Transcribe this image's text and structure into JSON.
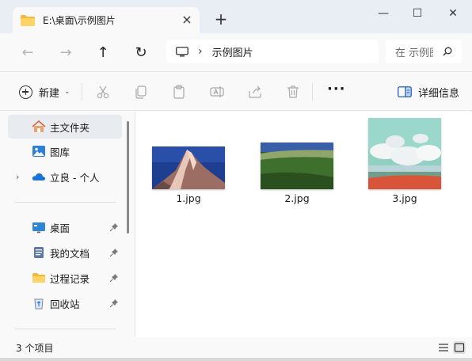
{
  "tab": {
    "title": "E:\\桌面\\示例图片",
    "close": "×",
    "new_tab": "+"
  },
  "window_controls": {
    "minimize": "—",
    "maximize": "☐",
    "close": "✕"
  },
  "nav": {
    "back": "←",
    "forward": "→",
    "up": "↑",
    "refresh": "↻"
  },
  "address": {
    "separator": "›",
    "crumb": "示例图片"
  },
  "search": {
    "placeholder": "在 示例图片 中搜索"
  },
  "commands": {
    "new_label": "新建",
    "more": "···",
    "details_label": "详细信息"
  },
  "sidebar": {
    "items": [
      {
        "label": "主文件夹",
        "icon": "home-icon",
        "selected": true
      },
      {
        "label": "图库",
        "icon": "gallery-icon"
      },
      {
        "label": "立良 - 个人",
        "icon": "onedrive-cloud-icon",
        "expander": "›"
      },
      {
        "label": "桌面",
        "icon": "desktop-icon",
        "pinned": true
      },
      {
        "label": "我的文档",
        "icon": "documents-icon",
        "pinned": true
      },
      {
        "label": "过程记录",
        "icon": "folder-icon",
        "pinned": true
      },
      {
        "label": "回收站",
        "icon": "recycle-bin-icon",
        "pinned": true
      }
    ]
  },
  "files": [
    {
      "name": "1.jpg",
      "subject": "snowy mountain peak"
    },
    {
      "name": "2.jpg",
      "subject": "green hillside"
    },
    {
      "name": "3.jpg",
      "subject": "sky with clouds over red field"
    }
  ],
  "status": {
    "count": "3 个项目"
  }
}
